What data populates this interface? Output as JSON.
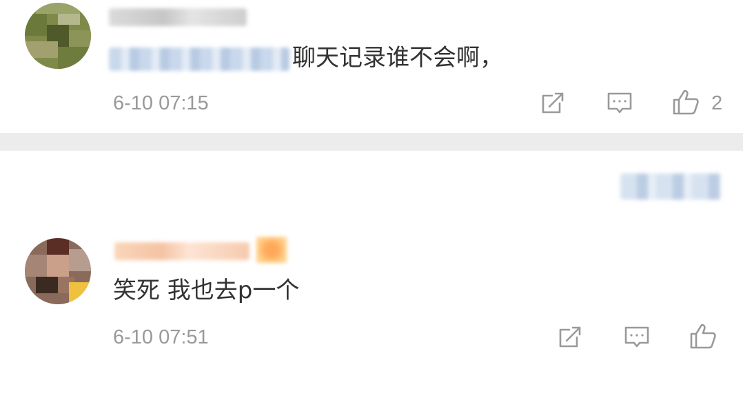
{
  "comments": [
    {
      "text": "聊天记录谁不会啊，",
      "time": "6-10 07:15",
      "like_count": "2"
    },
    {
      "text": "笑死 我也去p一个",
      "time": "6-10 07:51",
      "like_count": ""
    }
  ],
  "icons": {
    "share": "share-icon",
    "reply": "comment-icon",
    "like": "thumbs-up-icon"
  },
  "colors": {
    "text": "#333333",
    "meta": "#999999",
    "divider": "#ececec"
  }
}
